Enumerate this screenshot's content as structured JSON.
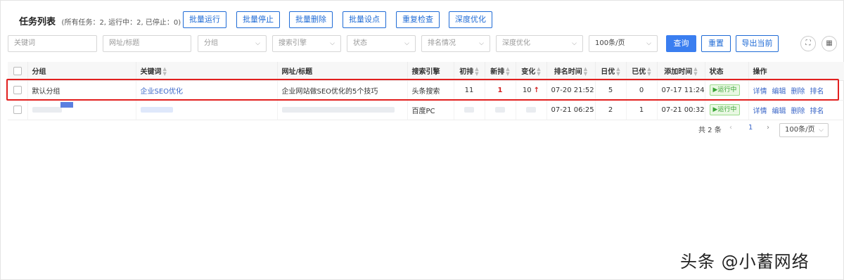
{
  "header": {
    "title": "任务列表",
    "stats": "(所有任务：2, 运行中：2, 已停止：0)"
  },
  "toolbar": {
    "batch_run": "批量运行",
    "batch_stop": "批量停止",
    "batch_delete": "批量删除",
    "batch_set": "批量设点",
    "recheck": "重复检查",
    "deep_optimize": "深度优化"
  },
  "filters": {
    "keyword_placeholder": "关键词",
    "url_placeholder": "网址/标题",
    "group": "分组",
    "engine": "搜索引擎",
    "status": "状态",
    "ranking": "排名情况",
    "deep": "深度优化",
    "page_size": "100条/页",
    "query": "查询",
    "reset": "重置",
    "export": "导出当前"
  },
  "table": {
    "columns": [
      "分组",
      "关键词",
      "网址/标题",
      "搜索引擎",
      "初排",
      "新排",
      "变化",
      "排名时间",
      "日优",
      "已优",
      "添加时间",
      "状态",
      "操作"
    ],
    "rows": [
      {
        "group": "默认分组",
        "keyword": "企业SEO优化",
        "title": "企业网站做SEO优化的5个技巧",
        "engine": "头条搜索",
        "initial": "11",
        "new": "1",
        "change": "10",
        "rank_time": "07-20 21:52",
        "daily": "5",
        "done": "0",
        "added": "07-17 11:24",
        "status": "运行中"
      },
      {
        "group": "",
        "keyword": "",
        "title": "",
        "engine": "百度PC",
        "initial": "",
        "new": "",
        "change": "",
        "rank_time": "07-21 06:25",
        "daily": "2",
        "done": "1",
        "added": "07-21 00:32",
        "status": "运行中"
      }
    ],
    "actions": [
      "详情",
      "编辑",
      "删除",
      "排名"
    ],
    "status_color": "#3aa536",
    "change_arrow": "↑"
  },
  "pager": {
    "total": "共 2 条",
    "current": "1",
    "page_size": "100条/页"
  },
  "watermark": "头条 @小蓄网络",
  "colors": {
    "accent": "#1f6bd6",
    "highlight": "#e2201f"
  }
}
